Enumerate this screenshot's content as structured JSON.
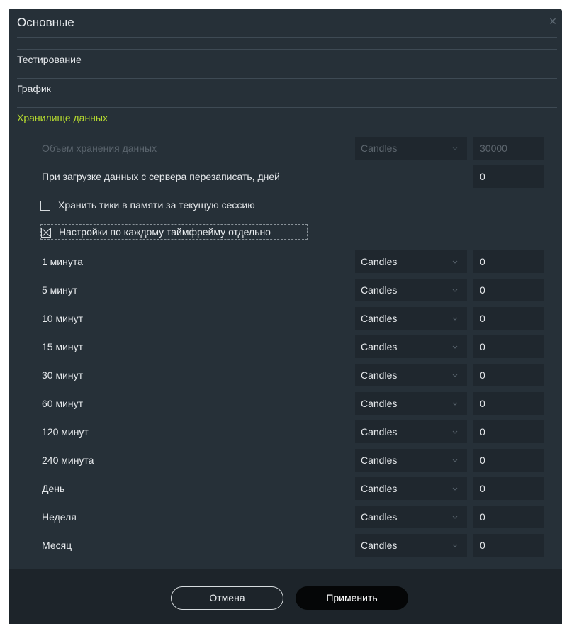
{
  "window": {
    "title": "Основные"
  },
  "sections": {
    "testing": "Тестирование",
    "chart": "График",
    "storage": "Хранилище данных"
  },
  "storage": {
    "volume_label": "Объем хранения данных",
    "volume_type": "Candles",
    "volume_value": "30000",
    "overwrite_label": "При загрузке данных с сервера перезаписать, дней",
    "overwrite_value": "0",
    "keep_ticks_label": "Хранить тики в памяти за текущую сессию",
    "keep_ticks_checked": false,
    "per_timeframe_label": "Настройки по каждому таймфрейму отдельно",
    "per_timeframe_checked": true
  },
  "timeframes": [
    {
      "label": "1 минута",
      "type": "Candles",
      "value": "0"
    },
    {
      "label": "5 минут",
      "type": "Candles",
      "value": "0"
    },
    {
      "label": "10 минут",
      "type": "Candles",
      "value": "0"
    },
    {
      "label": "15 минут",
      "type": "Candles",
      "value": "0"
    },
    {
      "label": "30 минут",
      "type": "Candles",
      "value": "0"
    },
    {
      "label": "60 минут",
      "type": "Candles",
      "value": "0"
    },
    {
      "label": "120 минут",
      "type": "Candles",
      "value": "0"
    },
    {
      "label": "240 минута",
      "type": "Candles",
      "value": "0"
    },
    {
      "label": "День",
      "type": "Candles",
      "value": "0"
    },
    {
      "label": "Неделя",
      "type": "Candles",
      "value": "0"
    },
    {
      "label": "Месяц",
      "type": "Candles",
      "value": "0"
    }
  ],
  "footer": {
    "cancel": "Отмена",
    "apply": "Применить"
  },
  "colors": {
    "accent": "#b7db2f",
    "background": "#263038",
    "field": "#1f272e",
    "footer": "#1d242a"
  }
}
